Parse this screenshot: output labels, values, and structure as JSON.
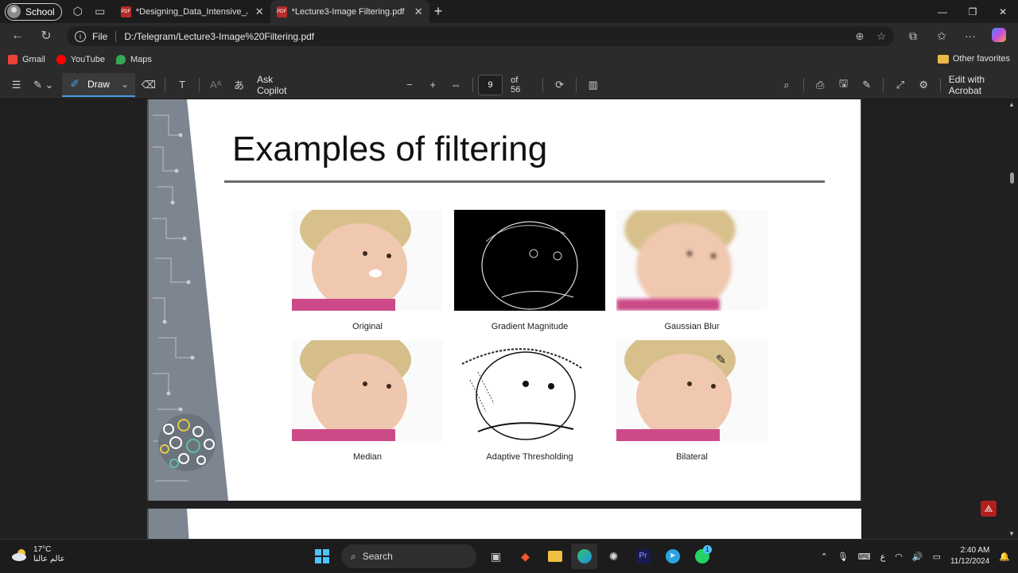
{
  "browser": {
    "profile_label": "School",
    "tabs": [
      {
        "title": "*Designing_Data_Intensive_Applic",
        "active": false
      },
      {
        "title": "*Lecture3-Image Filtering.pdf",
        "active": true
      }
    ],
    "address": {
      "scheme_label": "File",
      "url": "D:/Telegram/Lecture3-Image%20Filtering.pdf"
    },
    "bookmarks": [
      {
        "label": "Gmail",
        "icon": "gmail-icon",
        "color": "#ea4335"
      },
      {
        "label": "YouTube",
        "icon": "youtube-icon",
        "color": "#ff0000"
      },
      {
        "label": "Maps",
        "icon": "maps-icon",
        "color": "#34a853"
      }
    ],
    "other_favorites": "Other favorites"
  },
  "pdf_toolbar": {
    "draw_label": "Draw",
    "ask_copilot": "Ask Copilot",
    "page_current": "9",
    "page_total": "of 56",
    "edit_acrobat": "Edit with Acrobat"
  },
  "slide": {
    "title": "Examples of filtering",
    "images": [
      {
        "caption": "Original",
        "style": "color"
      },
      {
        "caption": "Gradient Magnitude",
        "style": "edges"
      },
      {
        "caption": "Gaussian Blur",
        "style": "blur"
      },
      {
        "caption": "Median",
        "style": "color"
      },
      {
        "caption": "Adaptive Thresholding",
        "style": "threshold"
      },
      {
        "caption": "Bilateral",
        "style": "color"
      }
    ]
  },
  "taskbar": {
    "temperature": "17°C",
    "weather_text": "عالم عالنا",
    "search_label": "Search",
    "time": "2:40 AM",
    "date": "11/12/2024",
    "lang": "ع",
    "whatsapp_badge": "1"
  },
  "colors": {
    "accent": "#4a9ae8",
    "sidebar_gray": "#7c8590",
    "acrobat_red": "#b21f1f"
  }
}
